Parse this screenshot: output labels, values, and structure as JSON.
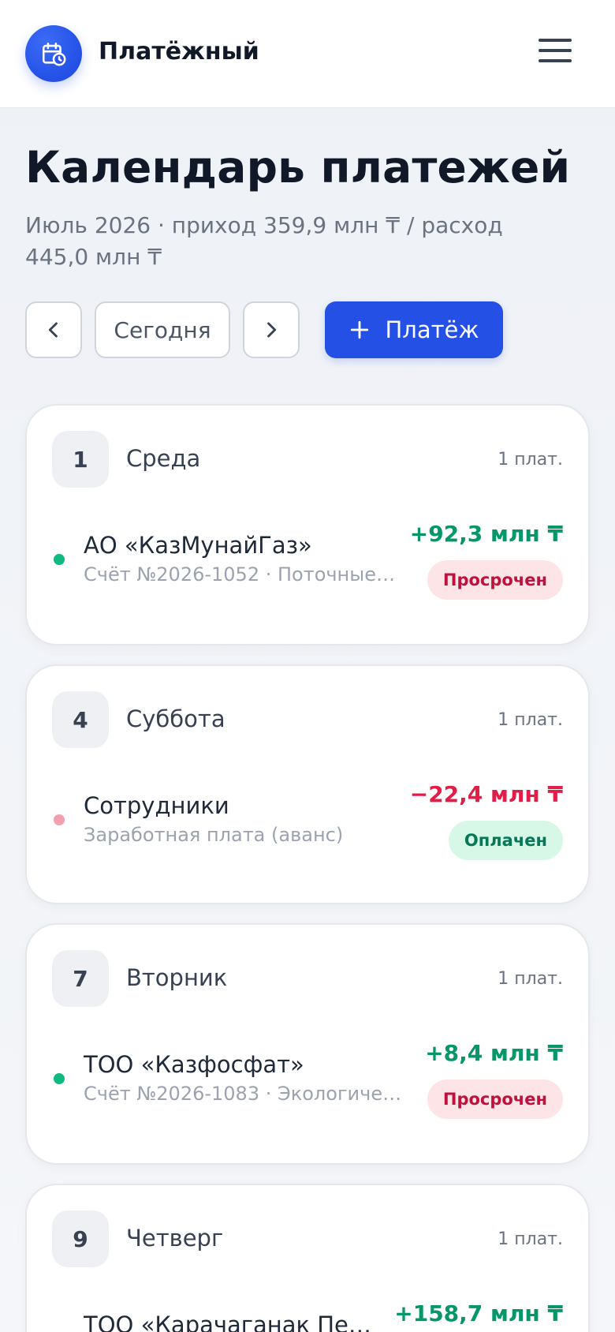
{
  "header": {
    "brand": "Платёжный",
    "logo_icon": "calendar-clock-icon",
    "menu_icon": "hamburger-menu-icon"
  },
  "page": {
    "title": "Календарь платежей",
    "subtitle": "Июль 2026 · приход 359,9 млн ₸ / расход 445,0 млн ₸"
  },
  "toolbar": {
    "prev_icon": "chevron-left-icon",
    "today_label": "Сегодня",
    "next_icon": "chevron-right-icon",
    "add_icon": "plus-icon",
    "add_label": "Платёж"
  },
  "colors": {
    "accent": "#2450e6",
    "income": "#059669",
    "expense": "#e11d48",
    "income_dot": "#10b981",
    "expense_dot": "#f3a0ac"
  },
  "days": [
    {
      "num": "1",
      "name": "Среда",
      "count": "1 плат.",
      "payments": [
        {
          "name": "АО «КазМунайГаз»",
          "desc": "Счёт №2026-1052 · Поточные …",
          "amount": "+92,3 млн ₸",
          "type": "income",
          "status": "Просрочен",
          "status_type": "overdue"
        }
      ]
    },
    {
      "num": "4",
      "name": "Суббота",
      "count": "1 плат.",
      "payments": [
        {
          "name": "Сотрудники",
          "desc": "Заработная плата (аванс)",
          "amount": "−22,4 млн ₸",
          "type": "expense",
          "status": "Оплачен",
          "status_type": "paid"
        }
      ]
    },
    {
      "num": "7",
      "name": "Вторник",
      "count": "1 плат.",
      "payments": [
        {
          "name": "ТОО «Казфосфат»",
          "desc": "Счёт №2026-1083 · Экологичес…",
          "amount": "+8,4 млн ₸",
          "type": "income",
          "status": "Просрочен",
          "status_type": "overdue"
        }
      ]
    },
    {
      "num": "9",
      "name": "Четверг",
      "count": "1 плат.",
      "payments": [
        {
          "name": "ТОО «Карачаганак Пет…",
          "desc": "",
          "amount": "+158,7 млн ₸",
          "type": "income",
          "status": "",
          "status_type": ""
        }
      ]
    }
  ]
}
